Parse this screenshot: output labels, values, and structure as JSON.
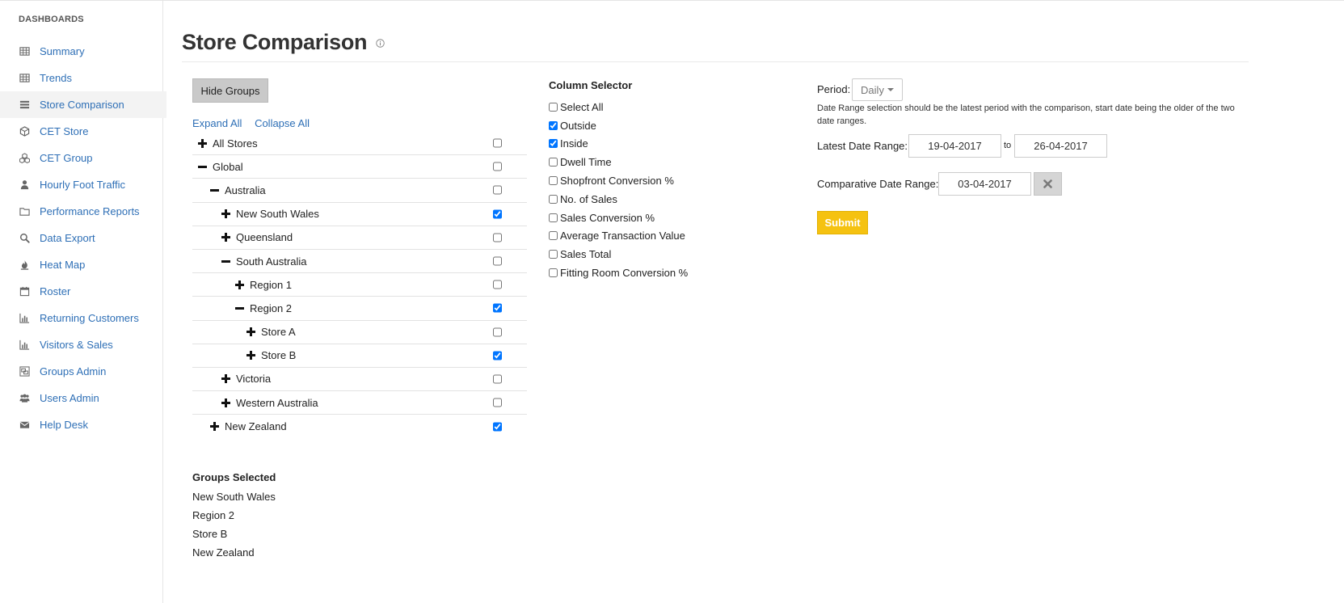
{
  "sidebar": {
    "heading": "DASHBOARDS",
    "items": [
      {
        "label": "Summary",
        "icon": "table-icon"
      },
      {
        "label": "Trends",
        "icon": "table-icon"
      },
      {
        "label": "Store Comparison",
        "icon": "list-icon"
      },
      {
        "label": "CET Store",
        "icon": "cube-icon"
      },
      {
        "label": "CET Group",
        "icon": "cubes-icon"
      },
      {
        "label": "Hourly Foot Traffic",
        "icon": "user-icon"
      },
      {
        "label": "Performance Reports",
        "icon": "folder-icon"
      },
      {
        "label": "Data Export",
        "icon": "search-icon"
      },
      {
        "label": "Heat Map",
        "icon": "fire-icon"
      },
      {
        "label": "Roster",
        "icon": "calendar-icon"
      },
      {
        "label": "Returning Customers",
        "icon": "bar-chart-icon"
      },
      {
        "label": "Visitors & Sales",
        "icon": "bar-chart-icon"
      },
      {
        "label": "Groups Admin",
        "icon": "object-group-icon"
      },
      {
        "label": "Users Admin",
        "icon": "users-icon"
      },
      {
        "label": "Help Desk",
        "icon": "envelope-icon"
      }
    ],
    "active": "Store Comparison"
  },
  "page": {
    "title": "Store Comparison",
    "hide_groups_label": "Hide Groups",
    "expand_all": "Expand All",
    "collapse_all": "Collapse All"
  },
  "tree": [
    {
      "label": "All Stores",
      "level": 0,
      "state": "collapsed",
      "checked": false
    },
    {
      "label": "Global",
      "level": 0,
      "state": "expanded",
      "checked": false
    },
    {
      "label": "Australia",
      "level": 1,
      "state": "expanded",
      "checked": false
    },
    {
      "label": "New South Wales",
      "level": 2,
      "state": "collapsed",
      "checked": true
    },
    {
      "label": "Queensland",
      "level": 2,
      "state": "collapsed",
      "checked": false
    },
    {
      "label": "South Australia",
      "level": 2,
      "state": "expanded",
      "checked": false
    },
    {
      "label": "Region 1",
      "level": 3,
      "state": "collapsed",
      "checked": false
    },
    {
      "label": "Region 2",
      "level": 3,
      "state": "expanded",
      "checked": true
    },
    {
      "label": "Store A",
      "level": 4,
      "state": "collapsed",
      "checked": false
    },
    {
      "label": "Store B",
      "level": 4,
      "state": "collapsed",
      "checked": true
    },
    {
      "label": "Victoria",
      "level": 2,
      "state": "collapsed",
      "checked": false
    },
    {
      "label": "Western Australia",
      "level": 2,
      "state": "collapsed",
      "checked": false
    },
    {
      "label": "New Zealand",
      "level": 1,
      "state": "collapsed",
      "checked": true
    }
  ],
  "groups_selected": {
    "title": "Groups Selected",
    "items": [
      "New South Wales",
      "Region 2",
      "Store B",
      "New Zealand"
    ]
  },
  "column_selector": {
    "title": "Column Selector",
    "items": [
      {
        "label": "Select All",
        "checked": false
      },
      {
        "label": "Outside",
        "checked": true
      },
      {
        "label": "Inside",
        "checked": true
      },
      {
        "label": "Dwell Time",
        "checked": false
      },
      {
        "label": "Shopfront Conversion %",
        "checked": false
      },
      {
        "label": "No. of Sales",
        "checked": false
      },
      {
        "label": "Sales Conversion %",
        "checked": false
      },
      {
        "label": "Average Transaction Value",
        "checked": false
      },
      {
        "label": "Sales Total",
        "checked": false
      },
      {
        "label": "Fitting Room Conversion %",
        "checked": false
      }
    ]
  },
  "filters": {
    "period_label": "Period:",
    "period_value": "Daily",
    "help_text": "Date Range selection should be the latest period with the comparison, start date being the older of the two date ranges.",
    "latest_label": "Latest Date Range:",
    "latest_from": "19-04-2017",
    "to_label": "to",
    "latest_to": "26-04-2017",
    "comparative_label": "Comparative Date Range:",
    "comparative_date": "03-04-2017",
    "submit_label": "Submit"
  },
  "colors": {
    "link": "#2e6fb6",
    "submit": "#f5c211",
    "hide_groups_bg": "#c9c9c9"
  }
}
